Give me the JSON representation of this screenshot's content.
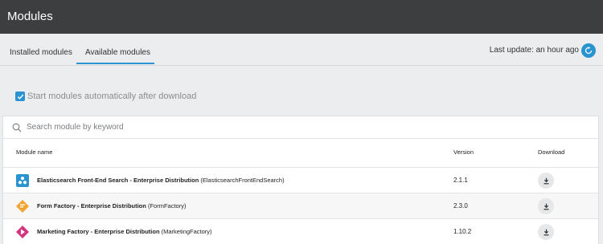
{
  "header": {
    "title": "Modules"
  },
  "tabs": [
    {
      "label": "Installed modules",
      "active": false
    },
    {
      "label": "Available modules",
      "active": true
    }
  ],
  "last_update": "Last update: an hour ago",
  "autostart": {
    "label": "Start modules automatically after download",
    "checked": true
  },
  "search": {
    "placeholder": "Search module by keyword",
    "value": ""
  },
  "table": {
    "columns": {
      "name": "Module name",
      "version": "Version",
      "download": "Download"
    },
    "rows": [
      {
        "title": "Elasticsearch Front-End Search - Enterprise Distribution",
        "id": "(ElasticsearchFrontEndSearch)",
        "version": "2.1.1",
        "icon": "elasticsearch-icon"
      },
      {
        "title": "Form Factory - Enterprise Distribution",
        "id": "(FormFactory)",
        "version": "2.3.0",
        "icon": "form-factory-icon"
      },
      {
        "title": "Marketing Factory - Enterprise Distribution",
        "id": "(MarketingFactory)",
        "version": "1.10.2",
        "icon": "marketing-factory-icon"
      }
    ]
  },
  "colors": {
    "accent": "#2a94d1",
    "topbar": "#3d3e40",
    "form_factory": "#f0a532",
    "marketing_factory": "#d6337f"
  }
}
